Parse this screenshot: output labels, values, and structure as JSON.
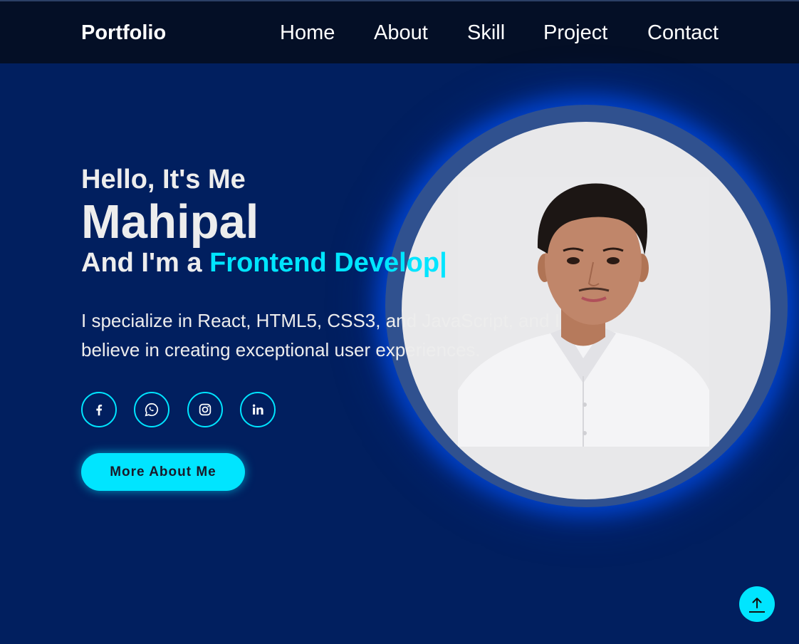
{
  "header": {
    "logo": "Portfolio",
    "nav": [
      {
        "label": "Home"
      },
      {
        "label": "About"
      },
      {
        "label": "Skill"
      },
      {
        "label": "Project"
      },
      {
        "label": "Contact"
      }
    ]
  },
  "hero": {
    "greeting": "Hello, It's Me",
    "name": "Mahipal",
    "role_prefix": "And I'm a ",
    "role_typed": "Frontend Develop|",
    "description": "I specialize in React, HTML5, CSS3, and JavaScript, and I believe in creating exceptional user experiences.",
    "social_icons": [
      "facebook-icon",
      "whatsapp-icon",
      "instagram-icon",
      "linkedin-icon"
    ],
    "cta_label": "More About Me"
  },
  "colors": {
    "background": "#011f5f",
    "header": "#040f26",
    "accent": "#00e5ff",
    "text": "#ededed"
  },
  "scroll_top_icon": "arrow-up-icon"
}
